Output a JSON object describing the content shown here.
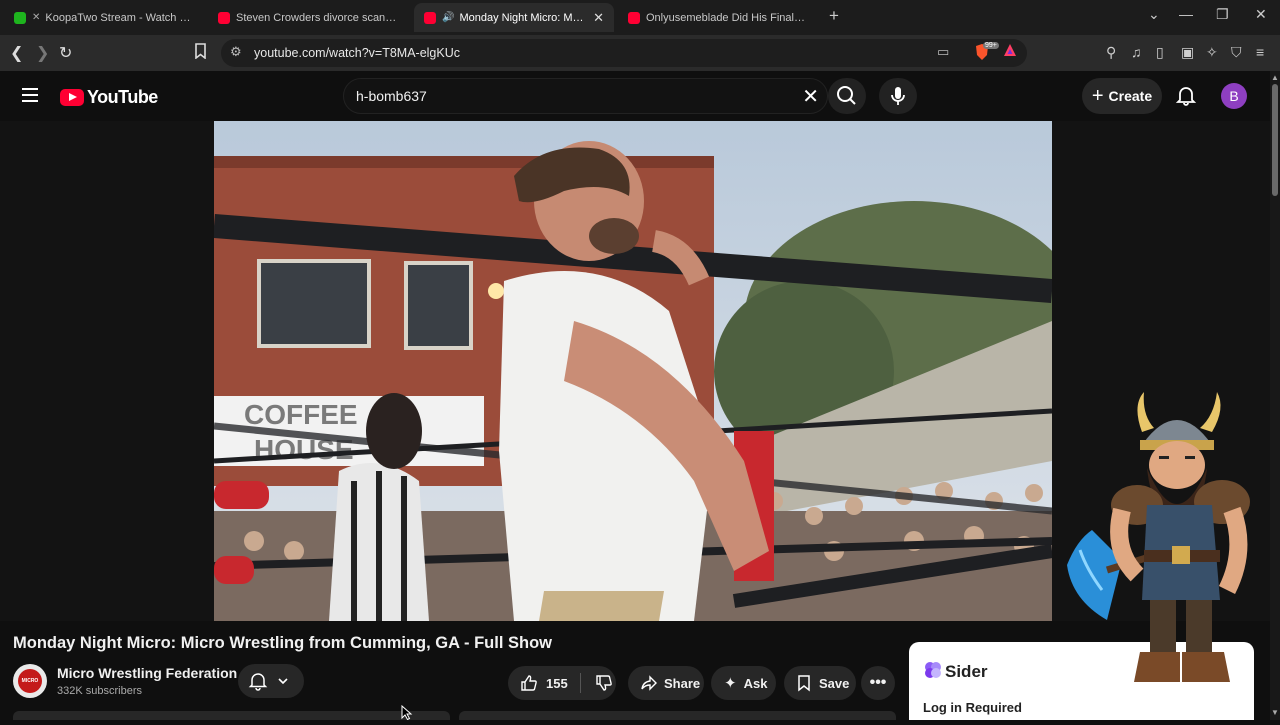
{
  "browser": {
    "tabs": [
      {
        "title": "KoopaTwo Stream - Watch Live o",
        "favicon": "kick-icon",
        "muted": true
      },
      {
        "title": "Steven Crowders divorce scandal | RE",
        "favicon": "youtube-icon"
      },
      {
        "title": "Monday Night Micro: Micro W",
        "favicon": "youtube-icon",
        "active": true,
        "audio": true
      },
      {
        "title": "Onlyusemeblade Did His Final Litty S",
        "favicon": "youtube-icon"
      }
    ],
    "url": "youtube.com/watch?v=T8MA-elgKUc",
    "brave_badge": "99+"
  },
  "youtube": {
    "logo_text": "YouTube",
    "search_value": "h-bomb637",
    "create_label": "Create",
    "avatar_letter": "B"
  },
  "video": {
    "title": "Monday Night Micro: Micro Wrestling from Cumming, GA - Full Show",
    "sign_text_line1": "COFFEE",
    "sign_text_line2": "HOUSE",
    "channel": {
      "name": "Micro Wrestling Federation",
      "subscribers": "332K subscribers",
      "avatar_text": "MICRO"
    },
    "actions": {
      "likes": "155",
      "share": "Share",
      "ask": "Ask",
      "save": "Save"
    }
  },
  "sider": {
    "name": "Sider",
    "login": "Log in Required"
  },
  "colors": {
    "youtube_red": "#ff0033",
    "avatar_purple": "#8e3fc1",
    "brave_orange": "#fb542b"
  }
}
